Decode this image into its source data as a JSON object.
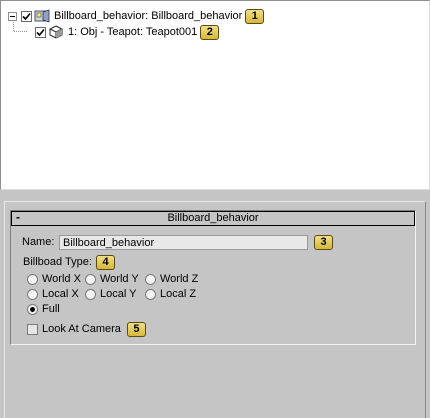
{
  "tree": {
    "rows": [
      {
        "label": "Billboard_behavior: Billboard_behavior",
        "badge": "1",
        "icon": "behavior-icon",
        "checked": true
      },
      {
        "label": "1: Obj - Teapot: Teapot001",
        "badge": "2",
        "icon": "object-cube-icon",
        "checked": true
      }
    ]
  },
  "rollout": {
    "collapse_symbol": "-",
    "title": "Billboard_behavior",
    "name_label": "Name:",
    "name_value": "Billboard_behavior",
    "name_badge": "3",
    "billboard_type_label": "Billboad Type:",
    "billboard_type_badge": "4",
    "options": [
      {
        "label": "World X",
        "checked": false
      },
      {
        "label": "World Y",
        "checked": false
      },
      {
        "label": "World Z",
        "checked": false
      },
      {
        "label": "Local X",
        "checked": false
      },
      {
        "label": "Local Y",
        "checked": false
      },
      {
        "label": "Local Z",
        "checked": false
      },
      {
        "label": "Full",
        "checked": true
      }
    ],
    "look_at_camera_label": "Look At Camera",
    "look_at_camera_checked": false,
    "look_at_camera_badge": "5"
  },
  "colors": {
    "panel_bg": "#c5c5c5",
    "tree_bg": "#ffffff",
    "badge_fill": "#e6c95a",
    "badge_border": "#5a4a14"
  }
}
